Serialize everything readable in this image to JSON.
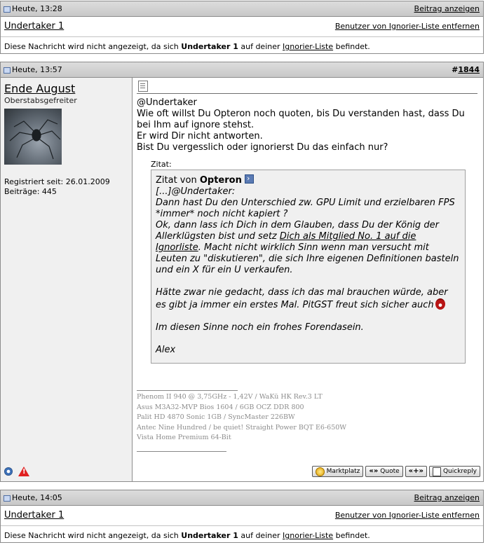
{
  "ignored_1": {
    "date": "Heute, 13:28",
    "view_link": "Beitrag anzeigen",
    "username": "Undertaker 1",
    "remove_link": "Benutzer von Ignorier-Liste entfernen",
    "msg_pre": "Diese Nachricht wird nicht angezeigt, da sich ",
    "msg_user": "Undertaker 1",
    "msg_mid": " auf deiner ",
    "msg_link": "Ignorier-Liste",
    "msg_post": " befindet."
  },
  "post": {
    "date": "Heute, 13:57",
    "number_prefix": "#",
    "number": "1844",
    "author": "Ende August",
    "rank": "Oberstabsgefreiter",
    "registered": "Registriert seit: 26.01.2009",
    "posts": "Beiträge: 445",
    "body": [
      "@Undertaker",
      "Wie oft willst Du Opteron noch quoten, bis Du verstanden hast, dass Du bei Ihm auf ignore stehst.",
      "Er wird Dir nicht antworten.",
      "Bist Du vergesslich oder ignorierst Du das einfach nur?"
    ],
    "quote_label": "Zitat:",
    "quote_from": "Zitat von ",
    "quote_author": "Opteron",
    "quote_lines": [
      "[...]@Undertaker:",
      "Dann hast Du den Unterschied zw. GPU Limit und erzielbaren FPS *immer* noch nicht kapiert ?",
      "Ok, dann lass ich Dich in dem Glauben, dass Du der König der Allerklügsten bist und setz "
    ],
    "quote_link": "Dich als Mitglied No. 1 auf die Ignorliste",
    "quote_after_link": ". Macht nicht wirklich Sinn wenn man versucht mit Leuten zu \"diskutieren\", die sich Ihre eigenen Definitionen basteln und ein X für ein U verkaufen.",
    "quote_p2": "Hätte zwar nie gedacht, dass ich das mal brauchen würde, aber es gibt ja immer ein erstes Mal. PitGST freut sich sicher auch",
    "quote_p3": "Im diesen Sinne noch ein frohes Forendasein.",
    "quote_sign": "Alex",
    "signature": [
      "Phenom II 940 @ 3,75GHz - 1,42V / WaKü HK Rev.3 LT",
      "Asus M3A32-MVP Bios 1604 / 6GB OCZ DDR 800",
      "Palit HD 4870 Sonic 1GB / SyncMaster 226BW",
      "Antec Nine Hundred / be quiet! Straight Power BQT E6-650W",
      "Vista Home Premium 64-Bit"
    ],
    "buttons": {
      "marketplace": "Marktplatz",
      "quote": "Quote",
      "quote_glyph": "«»",
      "multiquote_glyph": "«+»",
      "quickreply": "Quickreply"
    }
  },
  "ignored_2": {
    "date": "Heute, 14:05",
    "view_link": "Beitrag anzeigen",
    "username": "Undertaker 1",
    "remove_link": "Benutzer von Ignorier-Liste entfernen",
    "msg_pre": "Diese Nachricht wird nicht angezeigt, da sich ",
    "msg_user": "Undertaker 1",
    "msg_mid": " auf deiner ",
    "msg_link": "Ignorier-Liste",
    "msg_post": " befindet."
  }
}
